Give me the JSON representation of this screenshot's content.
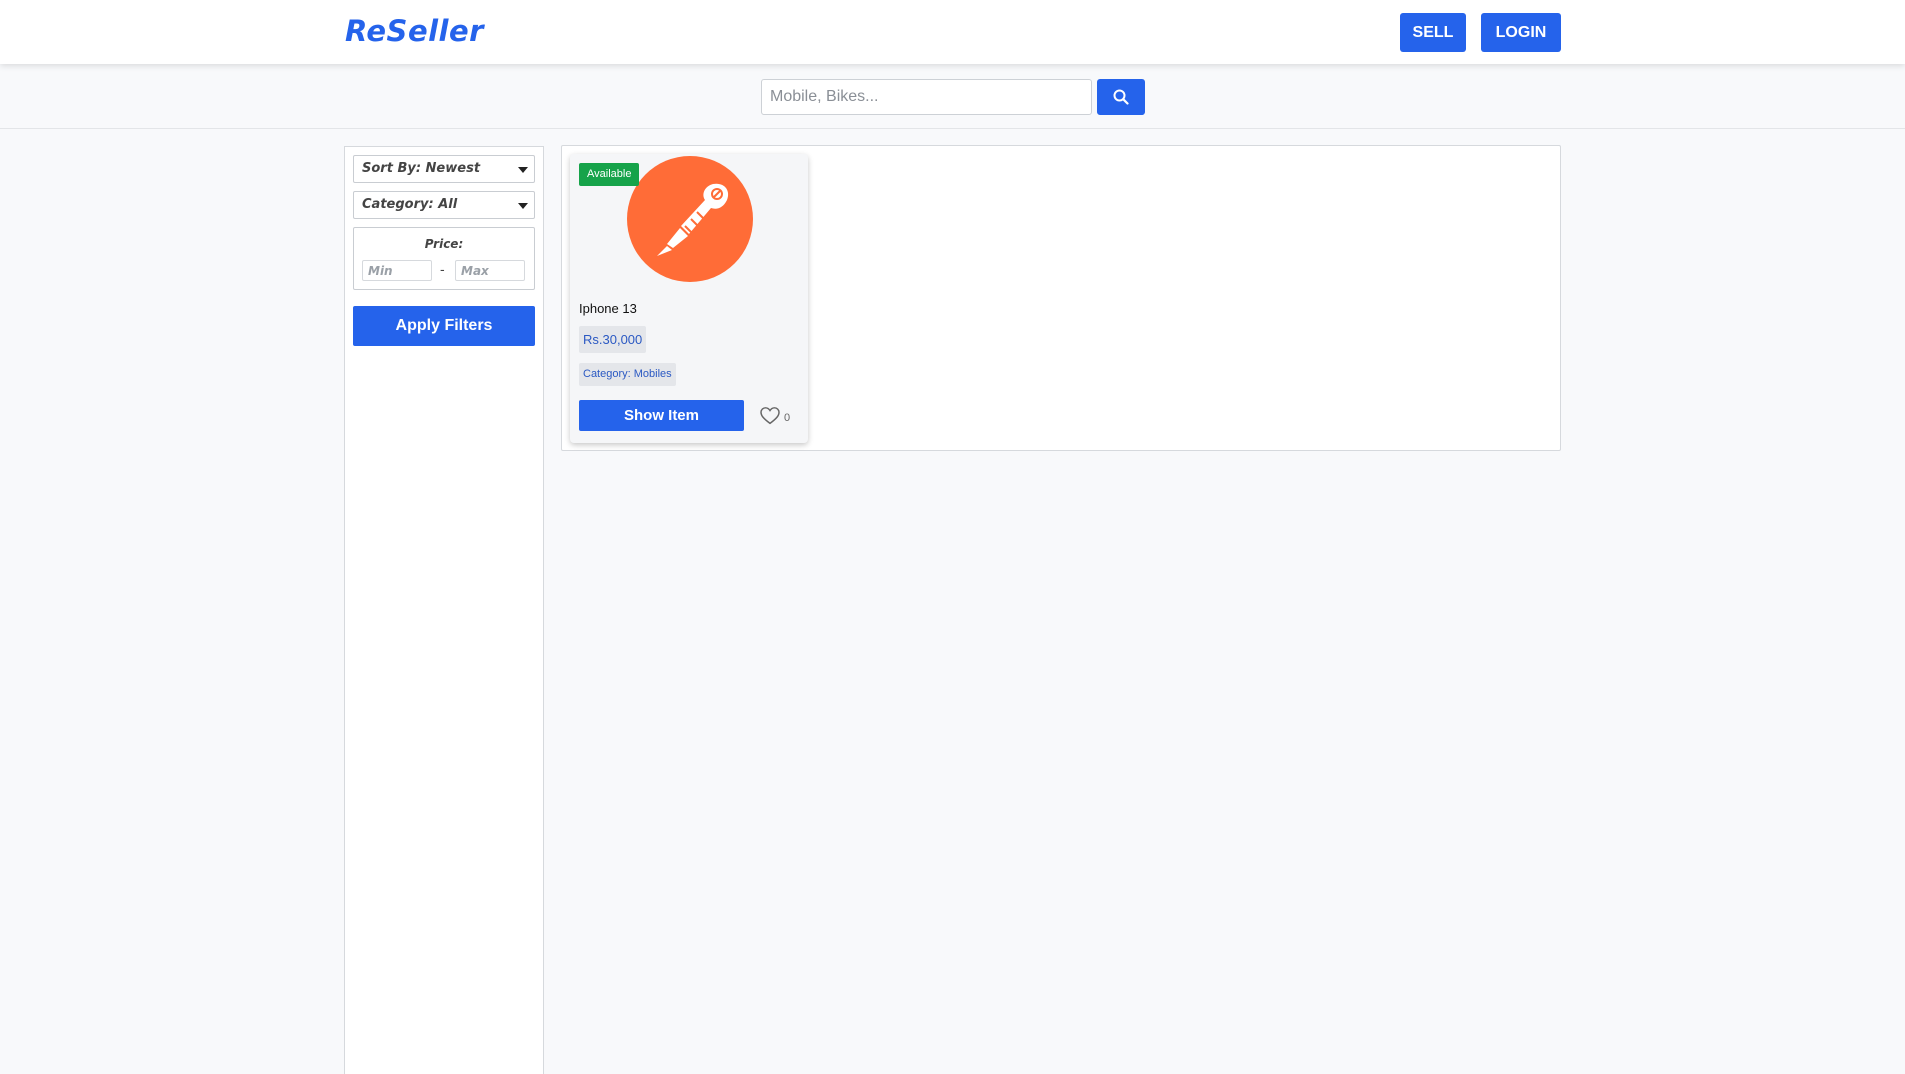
{
  "header": {
    "logo": "ReSeller",
    "sell_label": "SELL",
    "login_label": "LOGIN"
  },
  "search": {
    "placeholder": "Mobile, Bikes...",
    "value": ""
  },
  "filters": {
    "sort_label": "Sort By: Newest",
    "category_label": "Category: All",
    "price_label": "Price:",
    "min_placeholder": "Min",
    "max_placeholder": "Max",
    "price_separator": "-",
    "apply_label": "Apply Filters"
  },
  "items": [
    {
      "status": "Available",
      "status_color": "#16a34a",
      "title": "Iphone 13",
      "price": "Rs.30,000",
      "category": "Category: Mobiles",
      "show_label": "Show Item",
      "likes": "0",
      "image_icon": "postman-logo-icon",
      "image_color": "#ff6c37"
    }
  ],
  "colors": {
    "accent": "#2563eb",
    "page_background": "#f8f9fb"
  }
}
